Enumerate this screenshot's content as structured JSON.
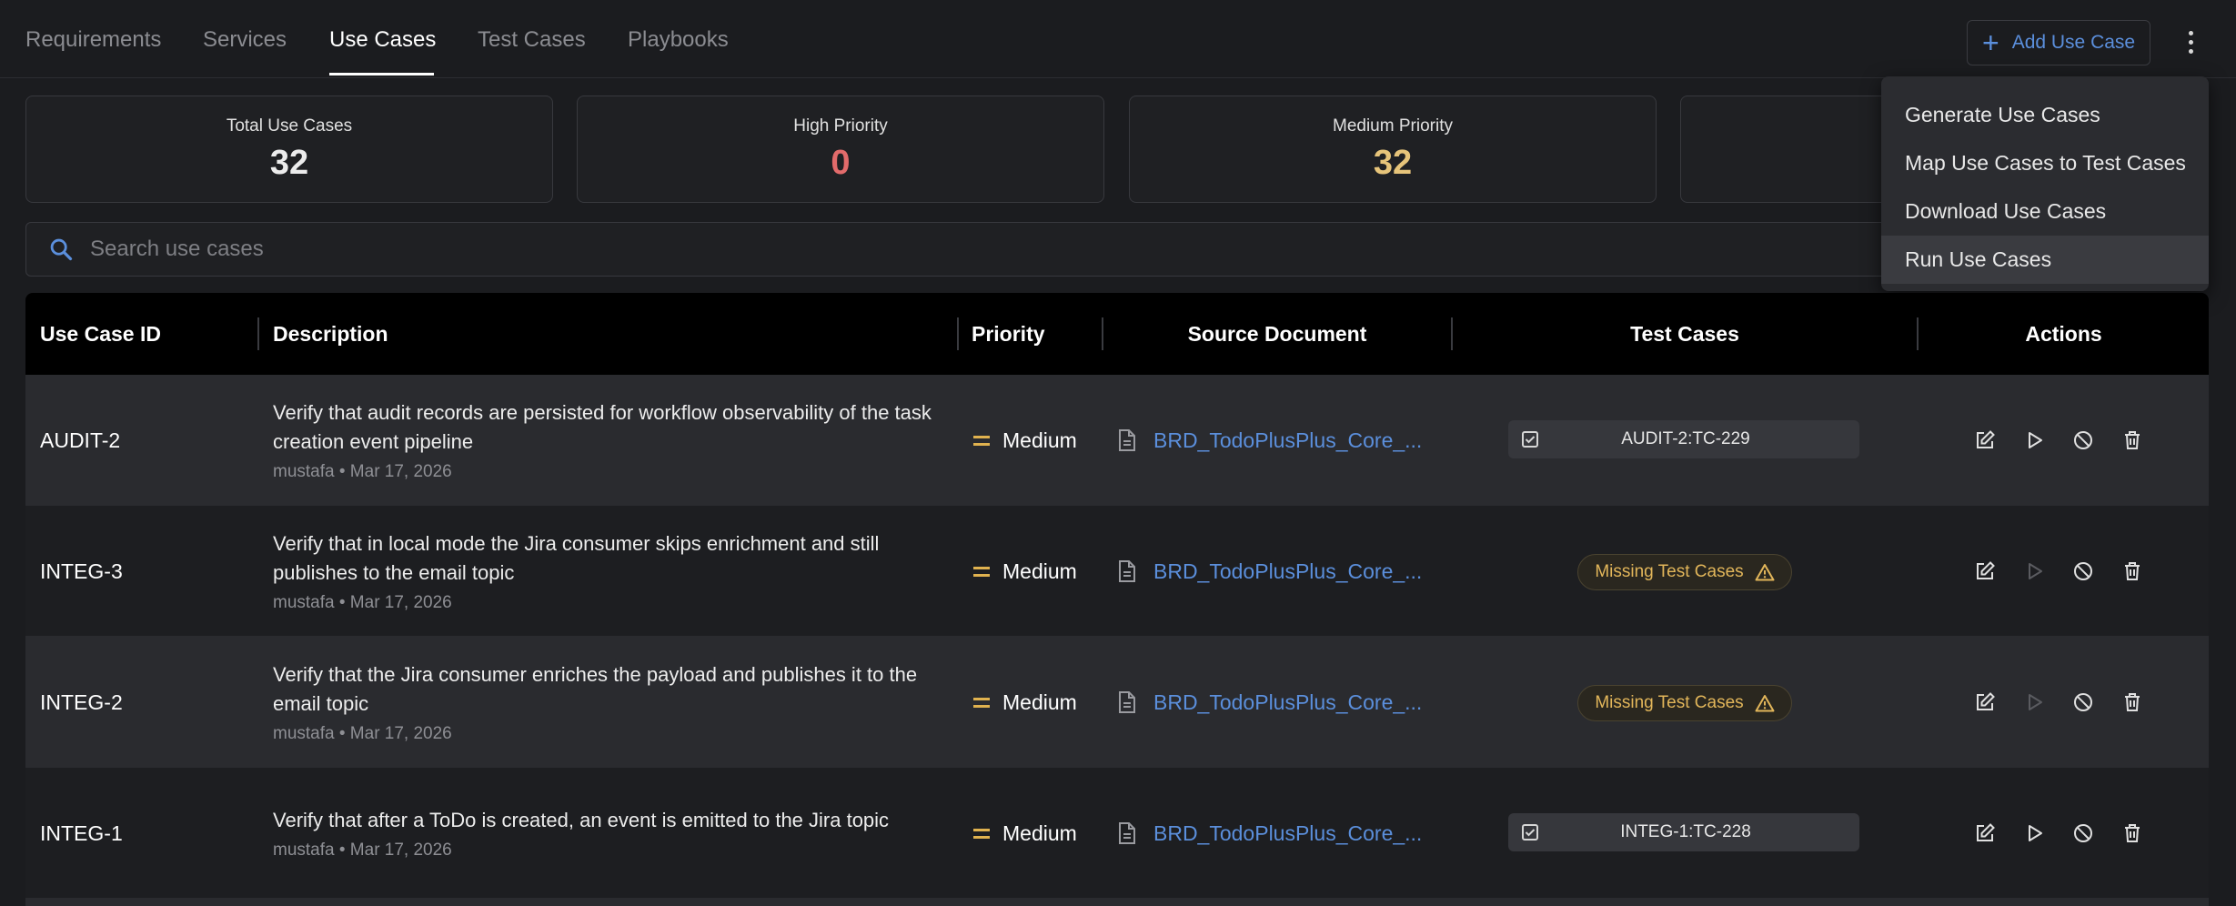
{
  "tabs": [
    {
      "label": "Requirements"
    },
    {
      "label": "Services"
    },
    {
      "label": "Use Cases"
    },
    {
      "label": "Test Cases"
    },
    {
      "label": "Playbooks"
    }
  ],
  "active_tab": "Use Cases",
  "toolbar": {
    "add_label": "Add Use Case",
    "more_icon": "more-vert-icon"
  },
  "stats": [
    {
      "label": "Total Use Cases",
      "value": "32",
      "color": "#ececec"
    },
    {
      "label": "High Priority",
      "value": "0",
      "color": "#e26b6b"
    },
    {
      "label": "Medium Priority",
      "value": "32",
      "color": "#e6c47a"
    }
  ],
  "search": {
    "placeholder": "Search use cases"
  },
  "table": {
    "headers": {
      "id": "Use Case ID",
      "description": "Description",
      "priority": "Priority",
      "source": "Source Document",
      "test_cases": "Test Cases",
      "actions": "Actions"
    },
    "rows": [
      {
        "id": "AUDIT-2",
        "description": "Verify that audit records are persisted for workflow observability of the task creation event pipeline",
        "meta": "mustafa • Mar 17, 2026",
        "priority": "Medium",
        "source": "BRD_TodoPlusPlus_Core_...",
        "test_case": "AUDIT-2:TC-229",
        "missing_label": ""
      },
      {
        "id": "INTEG-3",
        "description": "Verify that in local mode the Jira consumer skips enrichment and still publishes to the email topic",
        "meta": "mustafa • Mar 17, 2026",
        "priority": "Medium",
        "source": "BRD_TodoPlusPlus_Core_...",
        "test_case": "",
        "missing_label": "Missing Test Cases"
      },
      {
        "id": "INTEG-2",
        "description": "Verify that the Jira consumer enriches the payload and publishes it to the email topic",
        "meta": "mustafa • Mar 17, 2026",
        "priority": "Medium",
        "source": "BRD_TodoPlusPlus_Core_...",
        "test_case": "",
        "missing_label": "Missing Test Cases"
      },
      {
        "id": "INTEG-1",
        "description": "Verify that after a ToDo is created, an event is emitted to the Jira topic",
        "meta": "mustafa • Mar 17, 2026",
        "priority": "Medium",
        "source": "BRD_TodoPlusPlus_Core_...",
        "test_case": "INTEG-1:TC-228",
        "missing_label": ""
      }
    ]
  },
  "menu": {
    "items": [
      {
        "label": "Generate Use Cases"
      },
      {
        "label": "Map Use Cases to Test Cases"
      },
      {
        "label": "Download Use Cases"
      },
      {
        "label": "Run Use Cases"
      }
    ],
    "highlighted": "Run Use Cases"
  },
  "colors": {
    "accent": "#5b8fdc",
    "warning": "#e2b65a",
    "priority_medium": "#e0b24f"
  }
}
